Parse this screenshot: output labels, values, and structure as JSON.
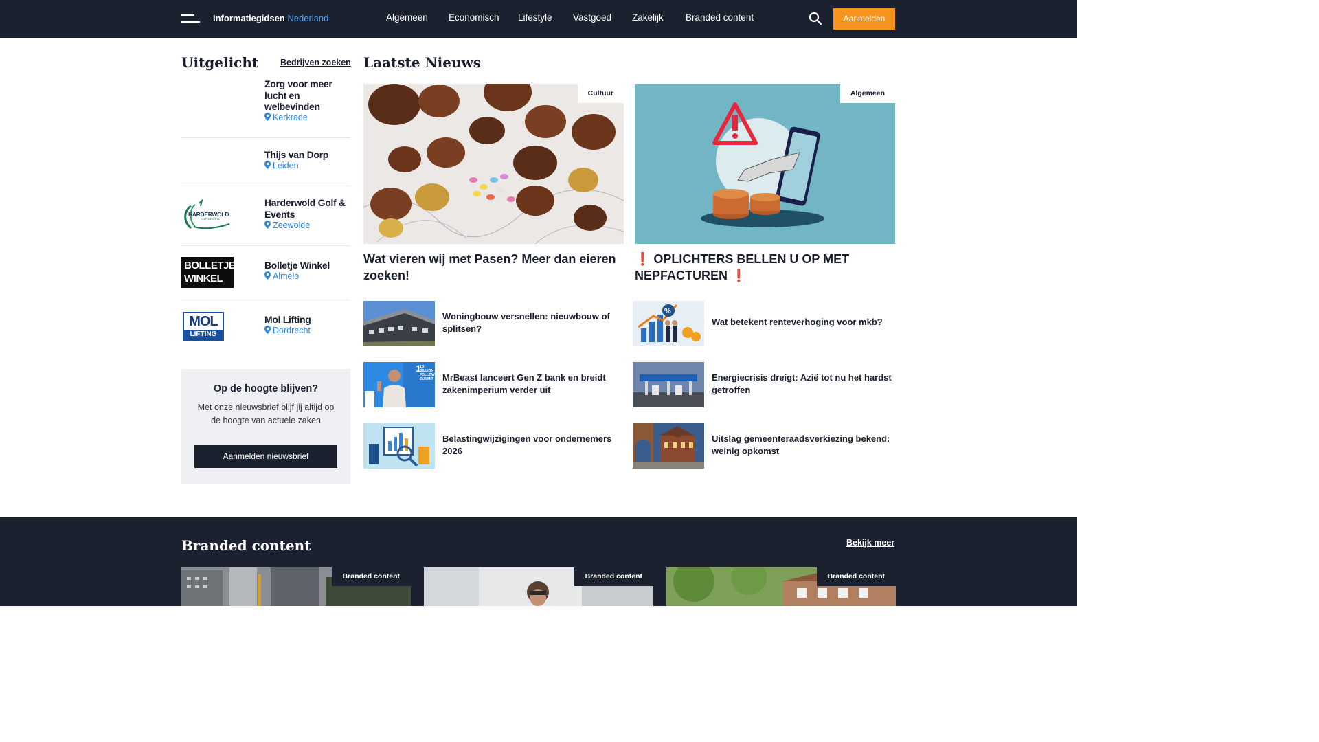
{
  "nav": {
    "brand_main": "Informatiegidsen",
    "brand_accent": "Nederland",
    "items": [
      "Algemeen",
      "Economisch",
      "Lifestyle",
      "Vastgoed",
      "Zakelijk",
      "Branded content"
    ],
    "login_label": "Aanmelden"
  },
  "featured": {
    "title": "Uitgelicht",
    "search_link": "Bedrijven zoeken",
    "items": [
      {
        "name": "Zorg voor meer lucht en welbevinden",
        "location": "Kerkrade",
        "logo": ""
      },
      {
        "name": "Thijs van Dorp",
        "location": "Leiden",
        "logo": ""
      },
      {
        "name": "Harderwold Golf & Events",
        "location": "Zeewolde",
        "logo": "HARDERWOLD",
        "logo_sub": "GOLF & EVENTS"
      },
      {
        "name": "Bolletje Winkel",
        "location": "Almelo",
        "logo": "BOLLETJE",
        "logo_line2": "WINKEL"
      },
      {
        "name": "Mol Lifting",
        "location": "Dordrecht",
        "logo": "MOL",
        "logo_line2": "LIFTING"
      }
    ]
  },
  "newsletter": {
    "title": "Op de hoogte blijven?",
    "text": "Met onze nieuwsbrief blijf jij altijd op de hoogte van actuele zaken",
    "button": "Aanmelden nieuwsbrief"
  },
  "news": {
    "title": "Laatste Nieuws",
    "big": [
      {
        "category": "Cultuur",
        "title": "Wat vieren wij met Pasen? Meer dan eieren zoeken!"
      },
      {
        "category": "Algemeen",
        "title": "❗ OPLICHTERS BELLEN U OP MET NEPFACTUREN ❗"
      }
    ],
    "small_left": [
      {
        "title": "Woningbouw versnellen: nieuwbouw of splitsen?"
      },
      {
        "title": "MrBeast lanceert Gen Z bank en breidt zakenimperium verder uit",
        "thumb_text": "1B BILLION FOLLOW SUMMIT"
      },
      {
        "title": "Belastingwijzigingen voor ondernemers 2026"
      }
    ],
    "small_right": [
      {
        "title": "Wat betekent renteverhoging voor mkb?"
      },
      {
        "title": "Energiecrisis dreigt: Azië tot nu het hardst getroffen"
      },
      {
        "title": "Uitslag gemeenteraadsverkiezing bekend: weinig opkomst"
      }
    ]
  },
  "branded": {
    "title": "Branded content",
    "more_link": "Bekijk meer",
    "cards": [
      {
        "tag": "Branded content"
      },
      {
        "tag": "Branded content"
      },
      {
        "tag": "Branded content"
      }
    ]
  },
  "colors": {
    "navy": "#1c2130",
    "accent_orange": "#f7941d",
    "link_blue": "#2e86d6",
    "alert_red": "#d6263a"
  }
}
